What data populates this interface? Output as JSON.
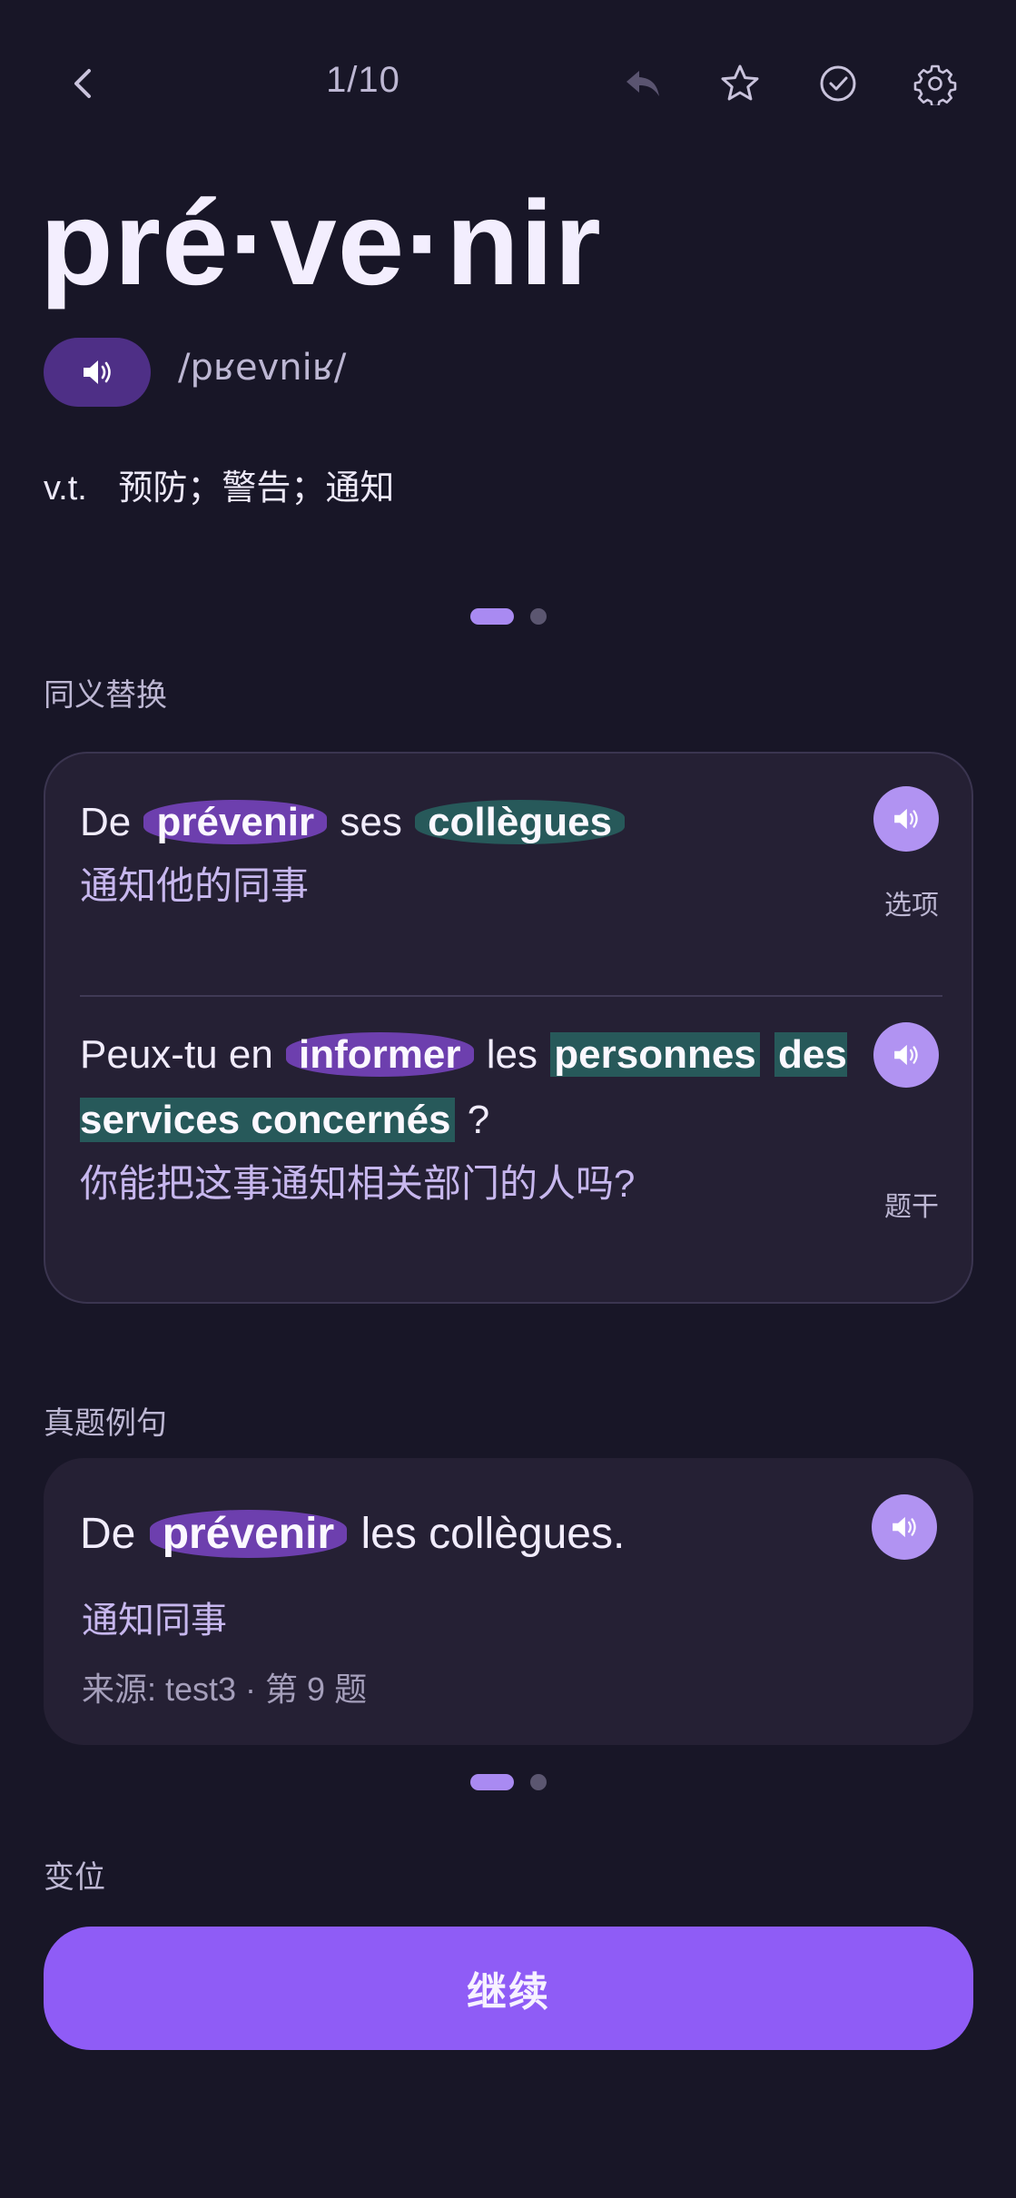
{
  "header": {
    "counter": "1/10"
  },
  "word": {
    "syllabified": "pré·ve·nir",
    "phonetic": "/pʁevniʁ/",
    "pos": "v.t.",
    "definition": "预防；警告；通知"
  },
  "synonyms": {
    "section_label": "同义替换",
    "entries": [
      {
        "fr_parts": [
          "De",
          "prévenir",
          "ses",
          "collègues"
        ],
        "zh": "通知他的同事",
        "tag": "选项"
      },
      {
        "fr_parts": [
          "Peux-tu en",
          "informer",
          "les",
          "personnes",
          "des services concernés",
          "?"
        ],
        "zh": "你能把这事通知相关部门的人吗?",
        "tag": "题干"
      }
    ]
  },
  "example": {
    "section_label": "真题例句",
    "fr_parts": [
      "De",
      "prévenir",
      "les collègues."
    ],
    "zh": "通知同事",
    "source": "来源: test3 · 第 9 题"
  },
  "variants": {
    "section_label": "变位"
  },
  "footer": {
    "continue_label": "继续"
  },
  "colors": {
    "background": "#181627",
    "accent": "#8f5cf6",
    "highlight_purple": "#6d3fae",
    "highlight_green": "#27595a"
  },
  "icons": [
    "chevron-left-icon",
    "undo-icon",
    "star-icon",
    "check-circle-icon",
    "gear-icon",
    "speaker-icon"
  ]
}
